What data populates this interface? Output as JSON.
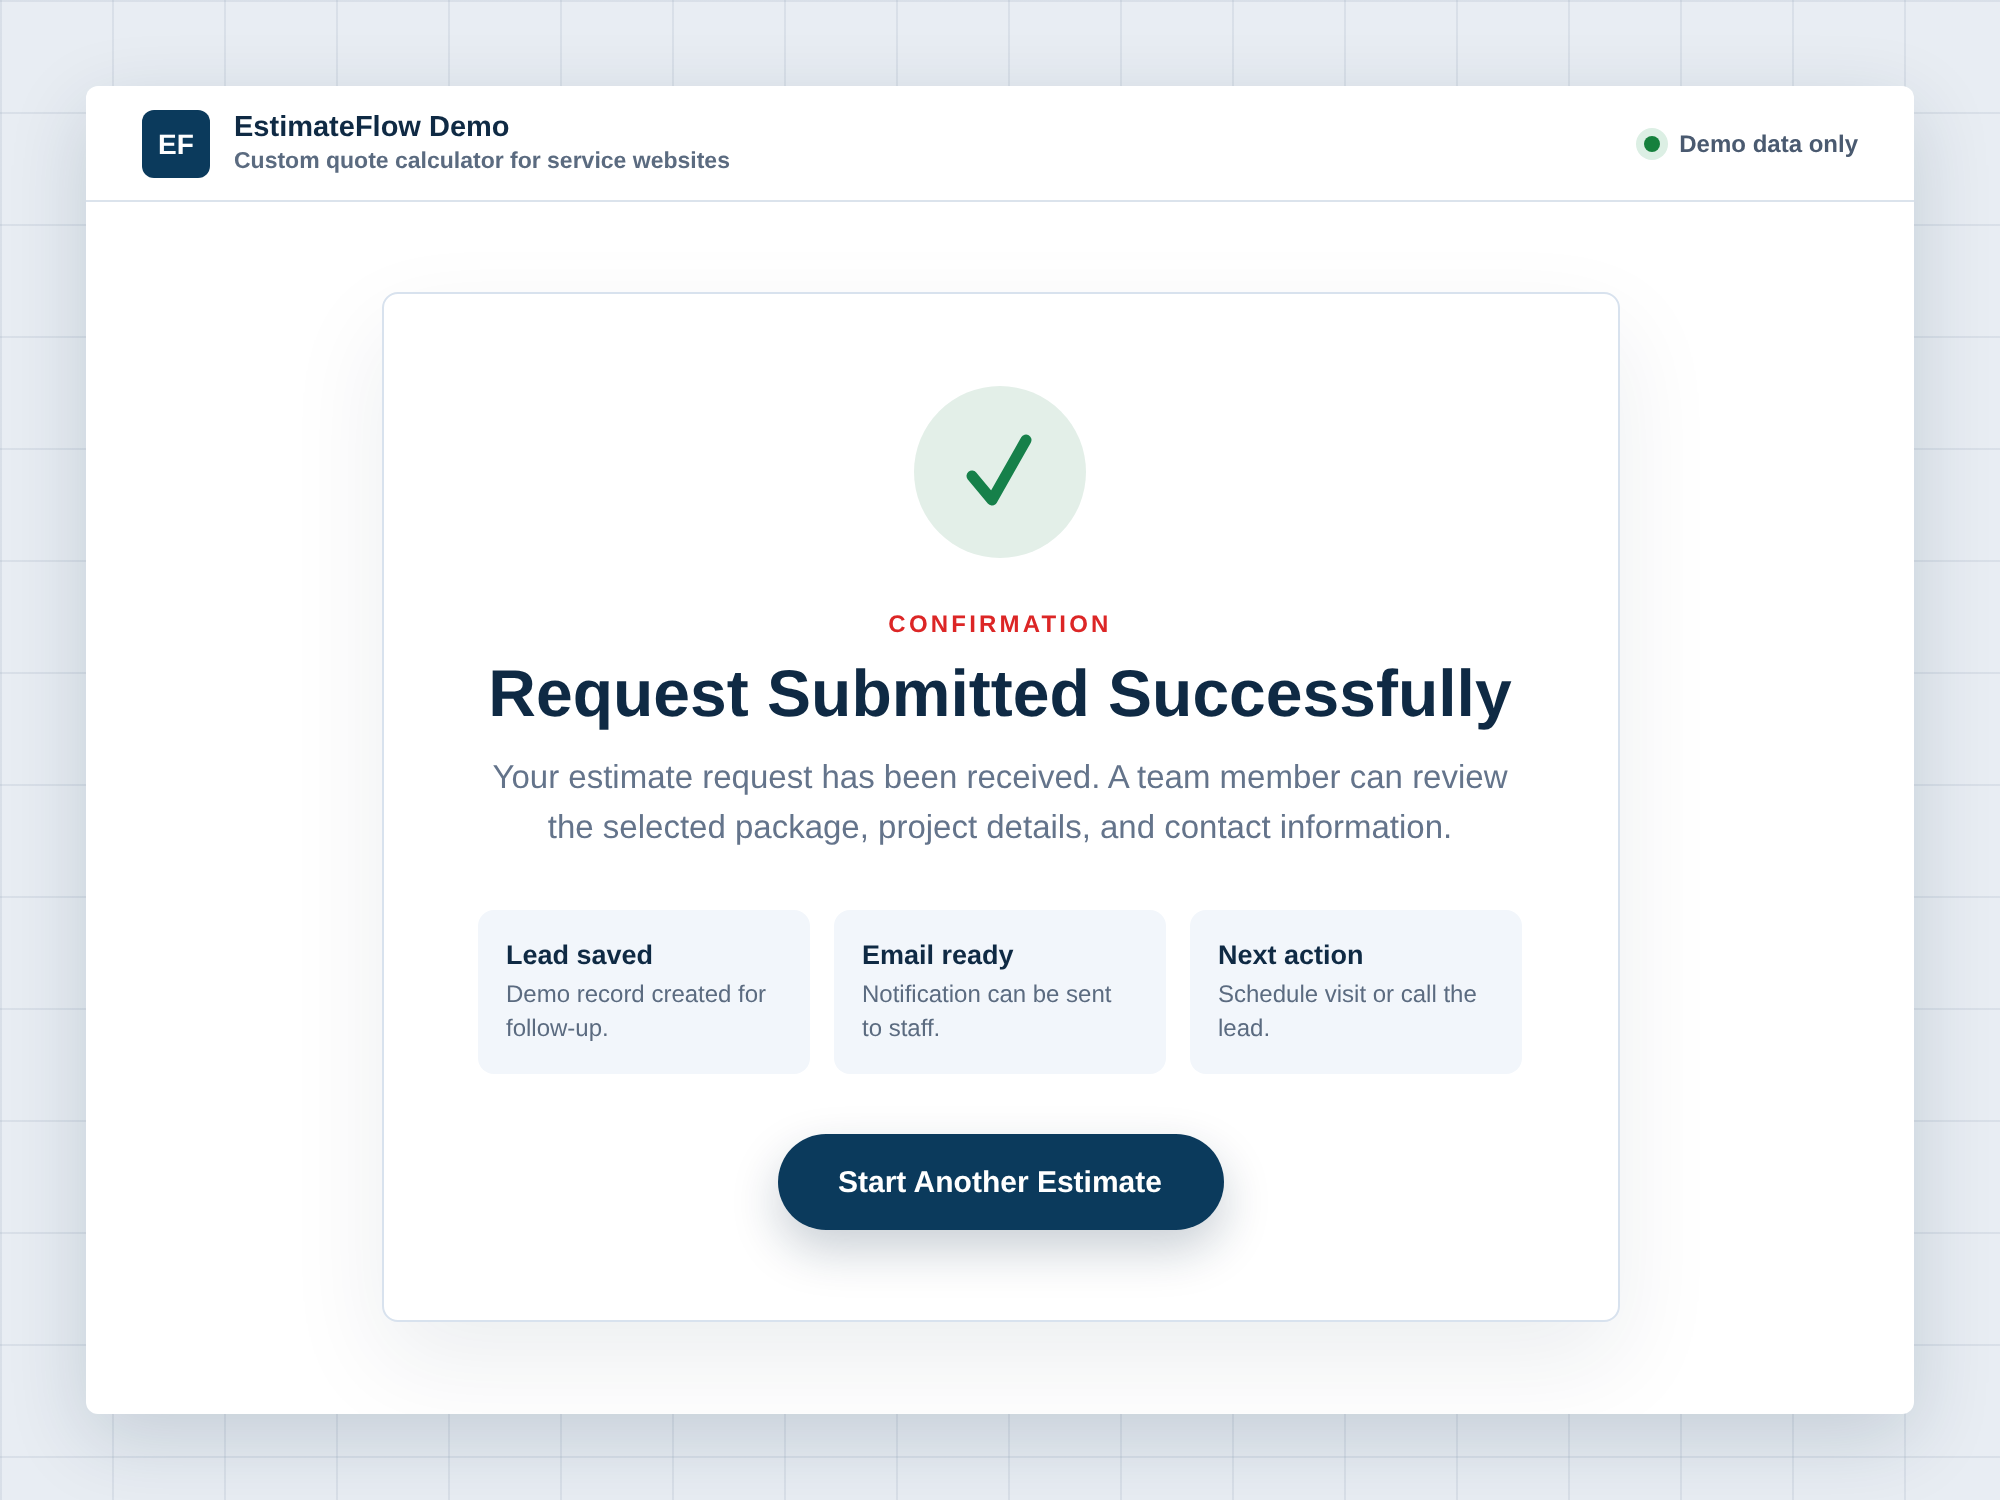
{
  "header": {
    "logo": "EF",
    "title": "EstimateFlow Demo",
    "subtitle": "Custom quote calculator for service websites",
    "status": {
      "label": "Demo data only"
    }
  },
  "confirmation": {
    "eyebrow": "CONFIRMATION",
    "title": "Request Submitted Successfully",
    "message": "Your estimate request has been received. A team member can review the selected package, project details, and contact information.",
    "cards": [
      {
        "title": "Lead saved",
        "text": "Demo record created for follow-up."
      },
      {
        "title": "Email ready",
        "text": "Notification can be sent to staff."
      },
      {
        "title": "Next action",
        "text": "Schedule visit or call the lead."
      }
    ],
    "button": "Start Another Estimate"
  }
}
